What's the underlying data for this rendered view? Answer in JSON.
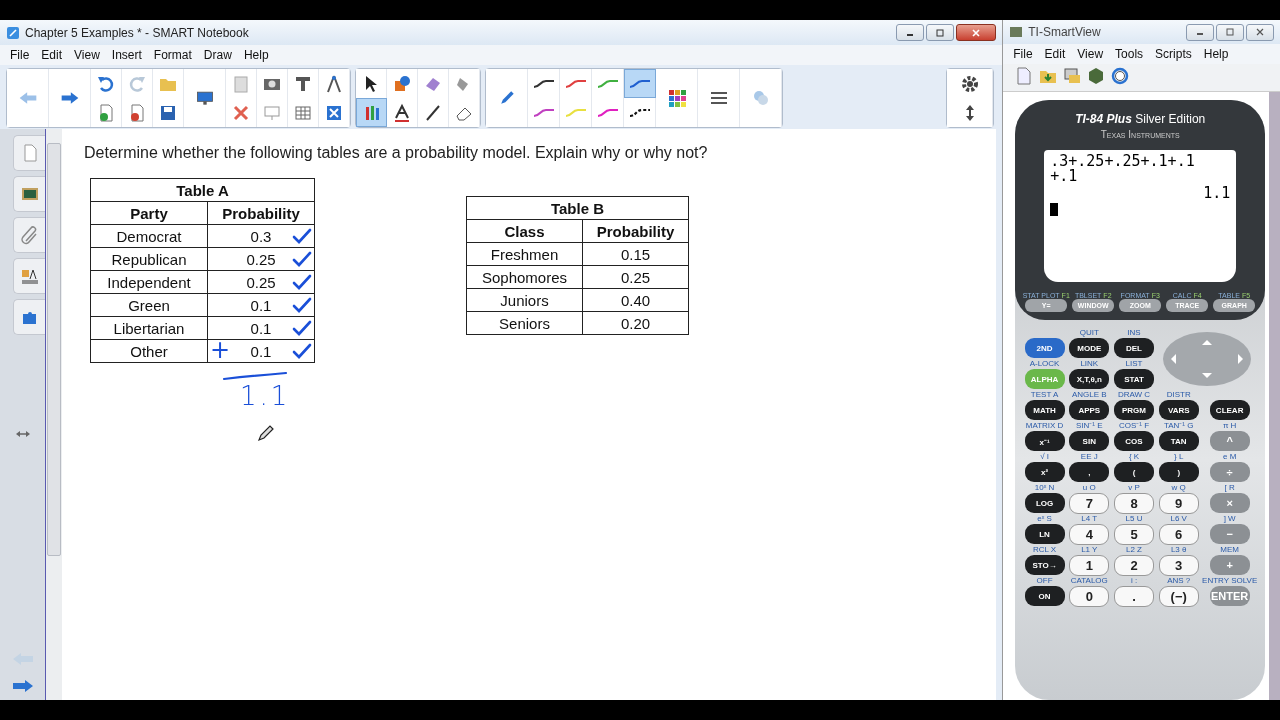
{
  "notebook": {
    "title": "Chapter 5 Examples * - SMART Notebook",
    "menu": [
      "File",
      "Edit",
      "View",
      "Insert",
      "Format",
      "Draw",
      "Help"
    ],
    "tools": [
      {
        "selected": false
      },
      {
        "selected": false
      },
      {
        "selected": false
      },
      {
        "selected": false
      },
      {
        "selected": true
      },
      {
        "selected": false
      },
      {
        "selected": false
      },
      {
        "selected": false
      }
    ],
    "pens": [
      {
        "color": "#333333",
        "selected": false
      },
      {
        "color": "#e04040",
        "selected": false
      },
      {
        "color": "#40b040",
        "selected": false
      },
      {
        "color": "#2060d0",
        "selected": true
      },
      {
        "color": "#c040c0",
        "selected": false
      },
      {
        "color": "#e8e040",
        "selected": false
      },
      {
        "color": "#e020c0",
        "selected": false
      },
      {
        "color": "#111111",
        "selected": false
      }
    ]
  },
  "page": {
    "question": "Determine whether the following tables are a probability model. Explain why or why not?",
    "table_a": {
      "title": "Table A",
      "columns": [
        "Party",
        "Probability"
      ],
      "rows": [
        {
          "cells": [
            "Democrat",
            "0.3"
          ],
          "checked": true
        },
        {
          "cells": [
            "Republican",
            "0.25"
          ],
          "checked": true
        },
        {
          "cells": [
            "Independent",
            "0.25"
          ],
          "checked": true
        },
        {
          "cells": [
            "Green",
            "0.1"
          ],
          "checked": true
        },
        {
          "cells": [
            "Libertarian",
            "0.1"
          ],
          "checked": true
        },
        {
          "cells": [
            "Other",
            "0.1"
          ],
          "checked": true
        }
      ],
      "ink_plus": "+",
      "ink_sum": "1.1"
    },
    "table_b": {
      "title": "Table B",
      "columns": [
        "Class",
        "Probability"
      ],
      "rows": [
        {
          "cells": [
            "Freshmen",
            "0.15"
          ]
        },
        {
          "cells": [
            "Sophomores",
            "0.25"
          ]
        },
        {
          "cells": [
            "Juniors",
            "0.40"
          ]
        },
        {
          "cells": [
            "Seniors",
            "0.20"
          ]
        }
      ]
    }
  },
  "calculator": {
    "title": "TI-SmartView",
    "menu": [
      "File",
      "Edit",
      "View",
      "Tools",
      "Scripts",
      "Help"
    ],
    "model": "TI-84 Plus",
    "edition": "Silver Edition",
    "brand": "Texas Instruments",
    "screen_lines": [
      ".3+.25+.25+.1+.1",
      "+.1"
    ],
    "result": "1.1",
    "fkeys": [
      {
        "label": "Y=",
        "second": "STAT PLOT",
        "f": "F1"
      },
      {
        "label": "WINDOW",
        "second": "TBLSET",
        "f": "F2"
      },
      {
        "label": "ZOOM",
        "second": "FORMAT",
        "f": "F3"
      },
      {
        "label": "TRACE",
        "second": "CALC",
        "f": "F4"
      },
      {
        "label": "GRAPH",
        "second": "TABLE",
        "f": "F5"
      }
    ],
    "keys": [
      {
        "label": "2ND",
        "kind": "blue"
      },
      {
        "label": "MODE",
        "second": "QUIT",
        "kind": "dark"
      },
      {
        "label": "DEL",
        "second": "INS",
        "kind": "dark"
      },
      {
        "label": "ALPHA",
        "second": "A-LOCK",
        "kind": "green"
      },
      {
        "label": "X,T,θ,n",
        "second": "LINK",
        "kind": "dark"
      },
      {
        "label": "STAT",
        "second": "LIST",
        "kind": "dark"
      },
      {
        "label": "MATH",
        "second": "TEST A",
        "kind": "dark"
      },
      {
        "label": "APPS",
        "second": "ANGLE B",
        "kind": "dark"
      },
      {
        "label": "PRGM",
        "second": "DRAW C",
        "kind": "dark"
      },
      {
        "label": "VARS",
        "second": "DISTR",
        "kind": "dark"
      },
      {
        "label": "CLEAR",
        "kind": "dark"
      },
      {
        "label": "x⁻¹",
        "second": "MATRIX D",
        "kind": "dark"
      },
      {
        "label": "SIN",
        "second": "SIN⁻¹ E",
        "kind": "dark"
      },
      {
        "label": "COS",
        "second": "COS⁻¹ F",
        "kind": "dark"
      },
      {
        "label": "TAN",
        "second": "TAN⁻¹ G",
        "kind": "dark"
      },
      {
        "label": "^",
        "second": "π H",
        "kind": "grey"
      },
      {
        "label": "x²",
        "second": "√ I",
        "kind": "dark"
      },
      {
        "label": ",",
        "second": "EE J",
        "kind": "dark"
      },
      {
        "label": "(",
        "second": "{ K",
        "kind": "dark"
      },
      {
        "label": ")",
        "second": "} L",
        "kind": "dark"
      },
      {
        "label": "÷",
        "second": "e M",
        "kind": "grey"
      },
      {
        "label": "LOG",
        "second": "10ˣ N",
        "kind": "dark"
      },
      {
        "label": "7",
        "second": "u O",
        "kind": "white"
      },
      {
        "label": "8",
        "second": "v P",
        "kind": "white"
      },
      {
        "label": "9",
        "second": "w Q",
        "kind": "white"
      },
      {
        "label": "×",
        "second": "[ R",
        "kind": "grey"
      },
      {
        "label": "LN",
        "second": "eˣ S",
        "kind": "dark"
      },
      {
        "label": "4",
        "second": "L4 T",
        "kind": "white"
      },
      {
        "label": "5",
        "second": "L5 U",
        "kind": "white"
      },
      {
        "label": "6",
        "second": "L6 V",
        "kind": "white"
      },
      {
        "label": "−",
        "second": "] W",
        "kind": "grey"
      },
      {
        "label": "STO→",
        "second": "RCL X",
        "kind": "dark"
      },
      {
        "label": "1",
        "second": "L1 Y",
        "kind": "white"
      },
      {
        "label": "2",
        "second": "L2 Z",
        "kind": "white"
      },
      {
        "label": "3",
        "second": "L3 θ",
        "kind": "white"
      },
      {
        "label": "+",
        "second": "MEM",
        "kind": "grey"
      },
      {
        "label": "ON",
        "second": "OFF",
        "kind": "dark"
      },
      {
        "label": "0",
        "second": "CATALOG",
        "kind": "white"
      },
      {
        "label": ".",
        "second": "i :",
        "kind": "white"
      },
      {
        "label": "(−)",
        "second": "ANS ?",
        "kind": "white"
      },
      {
        "label": "ENTER",
        "second": "ENTRY SOLVE",
        "kind": "grey"
      }
    ]
  }
}
